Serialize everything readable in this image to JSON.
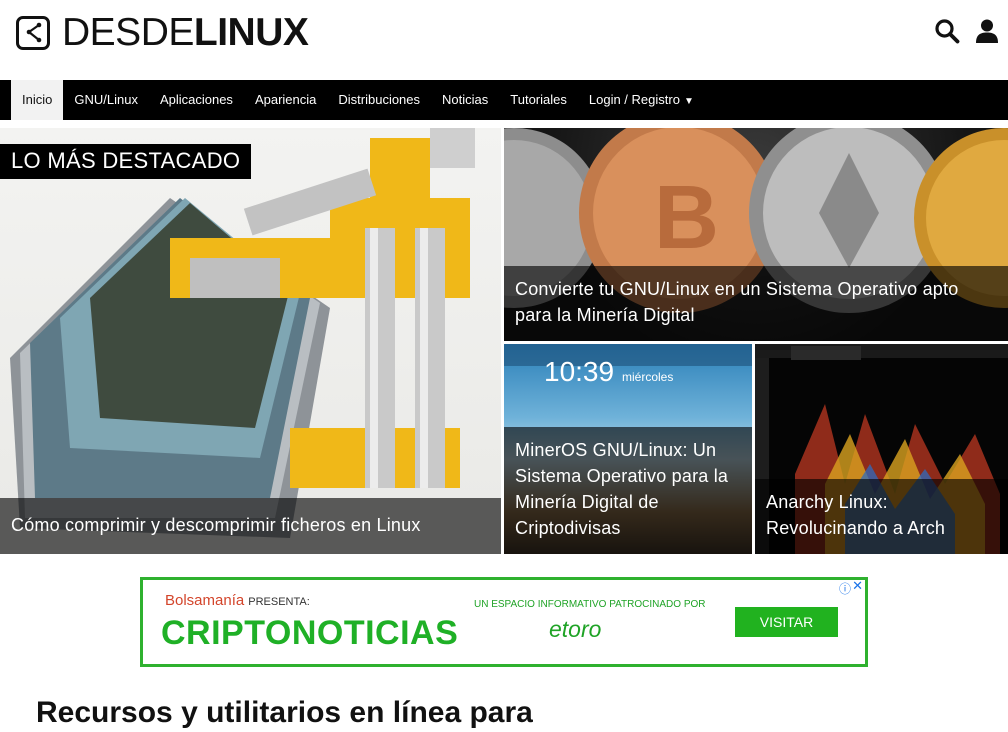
{
  "header": {
    "logo_part1": "DESDE",
    "logo_part2": "LINUX",
    "icons": [
      "search-icon",
      "user-icon"
    ]
  },
  "nav": {
    "items": [
      {
        "label": "Inicio",
        "active": true
      },
      {
        "label": "GNU/Linux"
      },
      {
        "label": "Aplicaciones"
      },
      {
        "label": "Apariencia"
      },
      {
        "label": "Distribuciones"
      },
      {
        "label": "Noticias"
      },
      {
        "label": "Tutoriales"
      },
      {
        "label": "Login / Registro",
        "caret": "▼"
      }
    ]
  },
  "featured": {
    "badge": "LO MÁS DESTACADO",
    "main_title": "Cómo comprimir y descomprimir ficheros en Linux",
    "crypto_title": "Convierte tu GNU/Linux en un Sistema Operativo apto para la Minería Digital",
    "miner_title": "MinerOS GNU/Linux: Un Sistema Operativo para la Minería Digital de Criptodivisas",
    "miner_clock": "10:39",
    "miner_day": "miércoles",
    "arch_title": "Anarchy Linux: Revolucinando a Arch"
  },
  "ad": {
    "brand_a": "Bolsa",
    "brand_b": "manía",
    "presenta": "PRESENTA:",
    "headline": "CRIPTONOTICIAS",
    "sub": "UN ESPACIO INFORMATIVO PATROCINADO POR",
    "sponsor": "etoro",
    "button": "VISITAR",
    "info": "ⓘ",
    "close": "✕"
  },
  "article": {
    "title": "Recursos y utilitarios en línea para"
  },
  "colors": {
    "nav_bg": "#000000",
    "ad_green": "#21b21f",
    "ad_red": "#d3452b"
  }
}
